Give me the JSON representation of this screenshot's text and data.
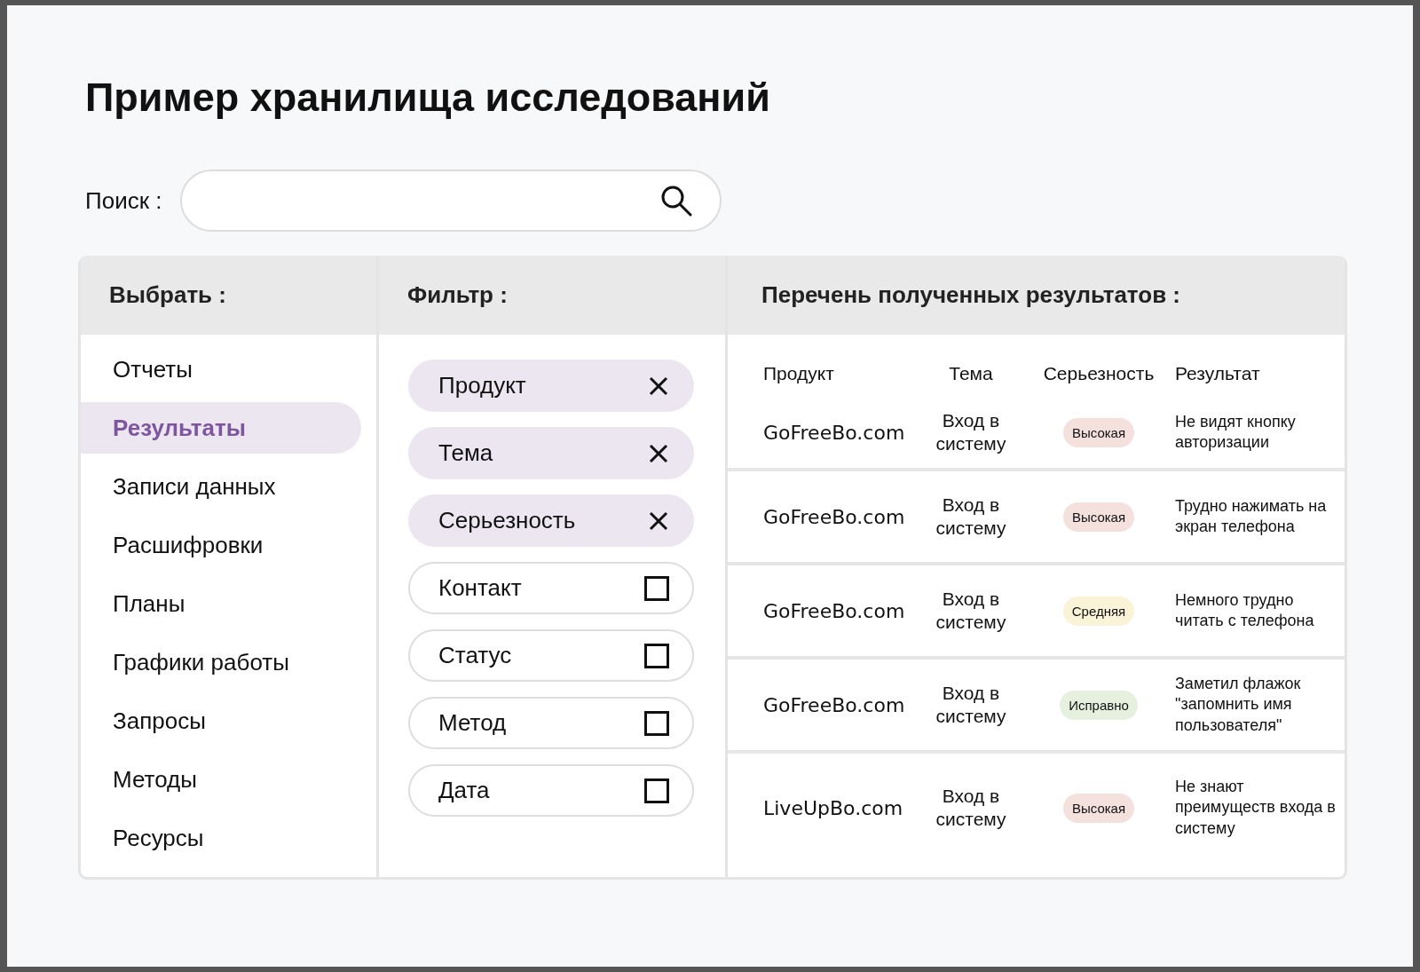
{
  "title": "Пример хранилища исследований",
  "search": {
    "label": "Поиск :"
  },
  "select_panel": {
    "heading": "Выбрать :",
    "items": [
      {
        "label": "Отчеты",
        "selected": false
      },
      {
        "label": "Результаты",
        "selected": true
      },
      {
        "label": "Записи данных",
        "selected": false
      },
      {
        "label": "Расшифровки",
        "selected": false
      },
      {
        "label": "Планы",
        "selected": false
      },
      {
        "label": "Графики работы",
        "selected": false
      },
      {
        "label": "Запросы",
        "selected": false
      },
      {
        "label": "Методы",
        "selected": false
      },
      {
        "label": "Ресурсы",
        "selected": false
      }
    ]
  },
  "filter_panel": {
    "heading": "Фильтр :",
    "filters": [
      {
        "label": "Продукт",
        "applied": true
      },
      {
        "label": "Тема",
        "applied": true
      },
      {
        "label": "Серьезность",
        "applied": true
      },
      {
        "label": "Контакт",
        "applied": false
      },
      {
        "label": "Статус",
        "applied": false
      },
      {
        "label": "Метод",
        "applied": false
      },
      {
        "label": "Дата",
        "applied": false
      }
    ]
  },
  "results_panel": {
    "heading": "Перечень полученных результатов :",
    "columns": [
      "Продукт",
      "Тема",
      "Серьезность",
      "Результат"
    ],
    "rows": [
      {
        "product": "GoFreeBo.com",
        "topic": "Вход в систему",
        "severity": "Высокая",
        "color": "#f4e0dc",
        "finding": "Не видят кнопку авторизации"
      },
      {
        "product": "GoFreeBo.com",
        "topic": "Вход в систему",
        "severity": "Высокая",
        "color": "#f4e0dc",
        "finding": "Трудно нажимать на экран телефона"
      },
      {
        "product": "GoFreeBo.com",
        "topic": "Вход в систему",
        "severity": "Средняя",
        "color": "#fbf3d8",
        "finding": "Немного трудно читать с телефона"
      },
      {
        "product": "GoFreeBo.com",
        "topic": "Вход в систему",
        "severity": "Исправно",
        "color": "#e6f0de",
        "finding": "Заметил флажок \"запомнить имя пользователя\""
      },
      {
        "product": "LiveUpBo.com",
        "topic": "Вход в систему",
        "severity": "Высокая",
        "color": "#f4e0dc",
        "finding": "Не знают преимуществ входа в систему"
      }
    ]
  }
}
